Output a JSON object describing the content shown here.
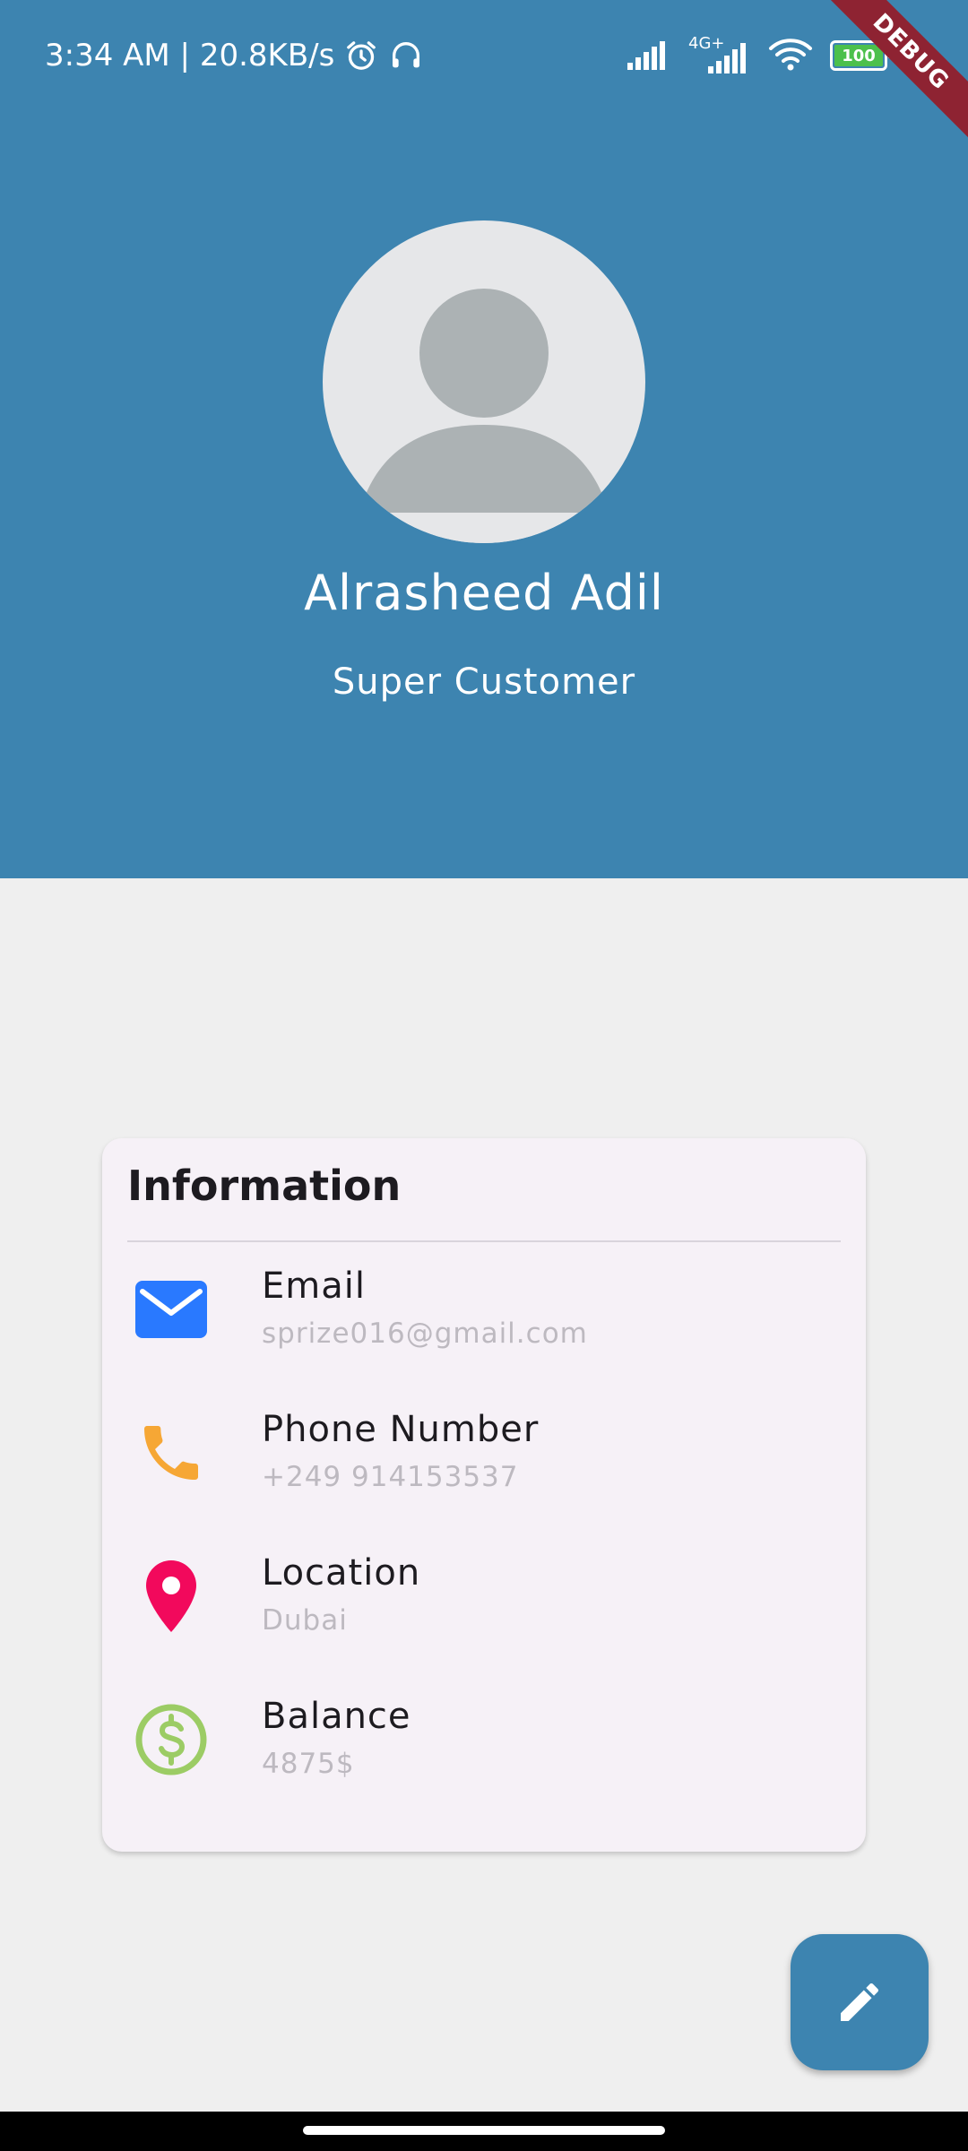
{
  "status_bar": {
    "time_speed": "3:34 AM | 20.8KB/s",
    "network_label": "4G+",
    "battery_level": "100",
    "debug_label": "DEBUG"
  },
  "profile": {
    "name": "Alrasheed Adil",
    "role": "Super Customer"
  },
  "info_card": {
    "title": "Information",
    "items": [
      {
        "label": "Email",
        "value": "sprize016@gmail.com",
        "icon": "email-icon",
        "color": "#2979ff"
      },
      {
        "label": "Phone Number",
        "value": "+249 914153537",
        "icon": "phone-icon",
        "color": "#f6a735"
      },
      {
        "label": "Location",
        "value": "Dubai",
        "icon": "location-pin-icon",
        "color": "#f2095c"
      },
      {
        "label": "Balance",
        "value": "4875$",
        "icon": "dollar-icon",
        "color": "#9ccc65"
      }
    ]
  },
  "fab": {
    "icon": "edit-pencil-icon"
  },
  "colors": {
    "primary": "#3d84b0",
    "background": "#efefef",
    "card": "#f6f1f7"
  }
}
